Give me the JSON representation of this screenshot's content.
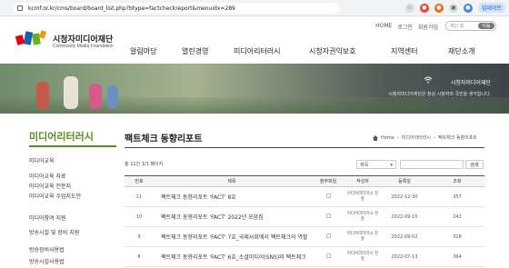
{
  "browser": {
    "url": "kcmf.or.kr/cms/board/board_list.php?btype=factcheckreport&menuidx=289",
    "update_label": "업데이트",
    "icons": [
      "lock-icon",
      "bookmark-star-icon",
      "extension-icon",
      "profile-icon"
    ]
  },
  "header": {
    "logo_name": "시청자미디어재단",
    "logo_sub": "Community Media Foundation",
    "util_links": [
      "HOME",
      "로그인",
      "회원가입"
    ],
    "search_placeholder": "재단 홈",
    "search_button": "이동",
    "gnb": [
      "알림마당",
      "열린경영",
      "미디어리터러시",
      "시청자권익보호",
      "지역센터",
      "재단소개"
    ]
  },
  "banner": {
    "brand": "시청자미디어재단",
    "slogan": "시청자미디어재단은 창상 시청자와 국민을 생각합니다."
  },
  "sidebar": {
    "title": "미디어리터러시",
    "items": [
      "미디어교육",
      "미디어교육 자료",
      "미디어교육 전문지",
      "미디어교육 수업지도안",
      "미디어참여 지원",
      "방송시설 및 장비 지원",
      "방송장비사용법",
      "방송시설사용법"
    ]
  },
  "content": {
    "title": "팩트체크 동향리포트",
    "breadcrumb": [
      "Home",
      "미디어리터러시",
      "팩트체크 동향리포트"
    ],
    "count_text": "총 11건 1/1 페이지",
    "search_select": "제목",
    "search_button": "검색",
    "table": {
      "headers": [
        "번호",
        "제목",
        "첨부파일",
        "작성자",
        "등록일",
        "조회"
      ],
      "rows": [
        {
          "no": "11",
          "title": "팩트체크 동향리포트 'FACT' 8호",
          "writer": "미디어리터러시 진흥",
          "date": "2022-12-30",
          "views": "357"
        },
        {
          "no": "10",
          "title": "팩트체크 동향리포트 'FACT' 2022년 모음집",
          "writer": "미디어리터러시 진흥",
          "date": "2022-09-15",
          "views": "242"
        },
        {
          "no": "9",
          "title": "팩트체크 동향리포트 'FACT' 7호_국제사회에서 팩트체크의 역할",
          "writer": "미디어리터러시 진흥",
          "date": "2022-09-02",
          "views": "318"
        },
        {
          "no": "8",
          "title": "팩트체크 동향리포트 'FACT' 6호_소셜미디어(SNS)와 팩트체크",
          "writer": "미디어리터러시 진흥",
          "date": "2022-07-13",
          "views": "364"
        }
      ]
    }
  },
  "colors": {
    "accent_green": "#5a8c1f",
    "logo_red": "#e60012",
    "logo_blue": "#1a5fb4",
    "logo_green": "#6ab023"
  }
}
